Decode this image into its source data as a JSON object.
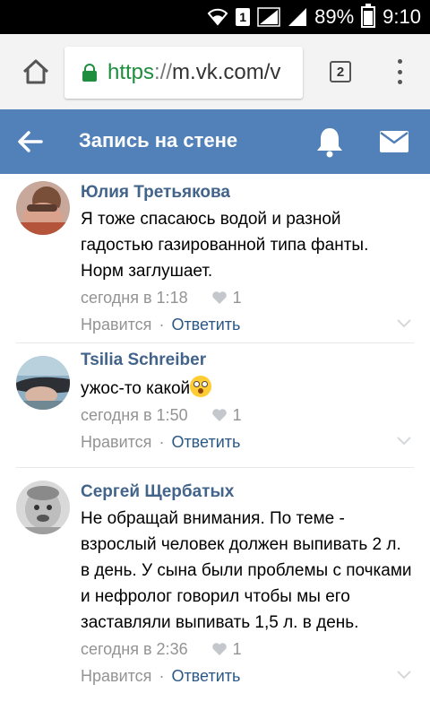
{
  "status_bar": {
    "sim": "1",
    "battery": "89%",
    "battery_level": 0.89,
    "time": "9:10",
    "icons": [
      "wifi-icon",
      "sim-icon",
      "signal-icon",
      "signal-icon",
      "battery-icon"
    ]
  },
  "browser": {
    "url_scheme": "https",
    "url_sep": "://",
    "url_host": "m.vk.com/v",
    "tab_count": "2"
  },
  "header": {
    "title": "Запись на стене",
    "color": "#5181b8"
  },
  "comments": [
    {
      "author": "Юлия Третьякова",
      "text": "Я тоже спасаюсь водой и разной гадостью газированной типа фанты. Норм заглушает.",
      "time": "сегодня в 1:18",
      "likes": "1",
      "like_label": "Нравится",
      "dot": "·",
      "reply_label": "Ответить"
    },
    {
      "author": "Tsilia Schreiber",
      "text": "ужос-то какой",
      "emoji": "flushed-face",
      "time": "сегодня в 1:50",
      "likes": "1",
      "like_label": "Нравится",
      "dot": "·",
      "reply_label": "Ответить"
    },
    {
      "author": "Сергей Щербатых",
      "text": "Не обращай внимания. По теме - взрослый человек должен выпивать 2 л. в день. У сына были проблемы с почками и нефролог говорил чтобы мы его заставляли выпивать 1,5 л. в день.",
      "time": "сегодня в 2:36",
      "likes": "1",
      "like_label": "Нравится",
      "dot": "·",
      "reply_label": "Ответить"
    }
  ],
  "colors": {
    "author": "#42648b",
    "link": "#2a5885",
    "meta": "#939393",
    "url_green": "#1e8e3e"
  }
}
